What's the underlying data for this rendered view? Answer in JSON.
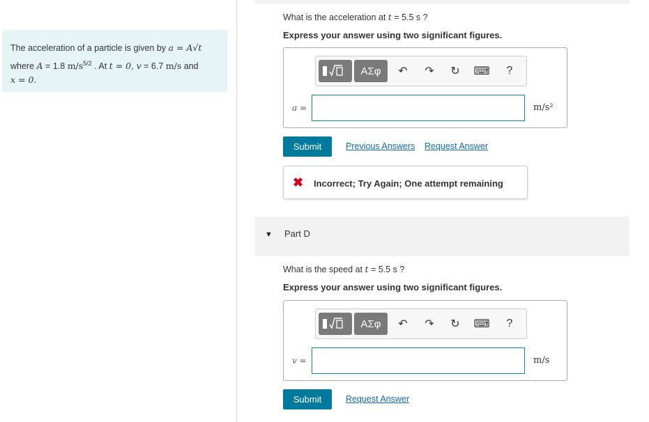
{
  "problem": {
    "text_prefix": "The acceleration of a particle is given by",
    "formula": "a = A√t",
    "line2_where": "where",
    "A_label": "A",
    "A_value": "= 1.8",
    "A_unit": "m/s",
    "A_exp": "5/2",
    "at_text": ". At",
    "t_cond": "t = 0,",
    "v_cond": "v",
    "v_value": "= 6.7",
    "v_unit": "m/s",
    "and_text": "and",
    "x_cond": "x = 0."
  },
  "partC": {
    "question_pre": "What is the acceleration at",
    "question_var": "t",
    "question_post": "= 5.5 s ?",
    "instruction": "Express your answer using two significant figures.",
    "variable": "a =",
    "unit": "m/s²",
    "input_value": "",
    "submit": "Submit",
    "previous_answers": "Previous Answers",
    "request_answer": "Request Answer",
    "feedback_icon": "✖",
    "feedback": "Incorrect; Try Again; One attempt remaining"
  },
  "partD": {
    "title": "Part D",
    "question_pre": "What is the speed at",
    "question_var": "t",
    "question_post": "= 5.5 s ?",
    "instruction": "Express your answer using two significant figures.",
    "variable": "v =",
    "unit": "m/s",
    "input_value": "",
    "submit": "Submit",
    "request_answer": "Request Answer"
  },
  "toolbar": {
    "greek": "ΑΣφ",
    "undo": "↶",
    "redo": "↷",
    "reset": "↻",
    "keyboard": "⌨",
    "help": "?"
  },
  "colors": {
    "accent": "#007a9c",
    "problem_bg": "#e6f4f6",
    "error": "#d0021b",
    "link": "#1268b3"
  }
}
